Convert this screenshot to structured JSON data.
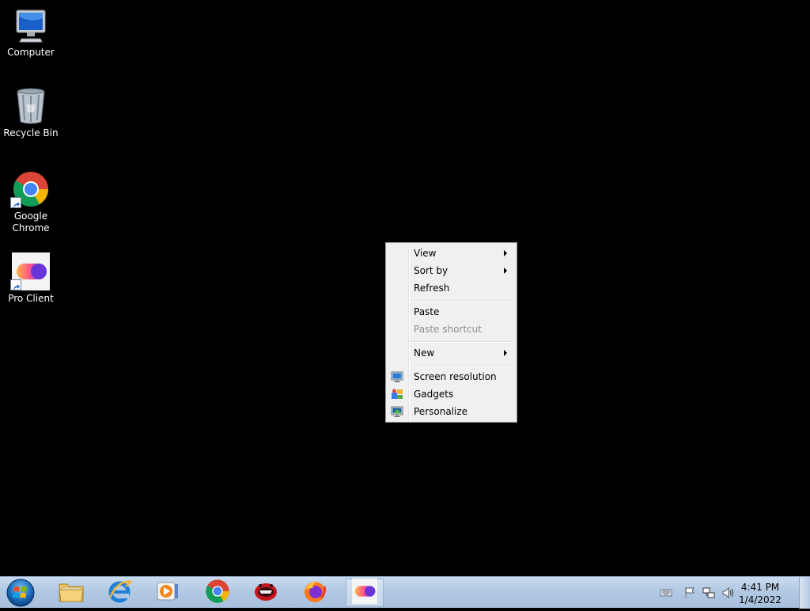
{
  "desktop": {
    "icons": [
      {
        "label": "Computer",
        "icon": "computer-icon"
      },
      {
        "label": "Recycle Bin",
        "icon": "recycle-bin-icon"
      },
      {
        "label": "Google Chrome",
        "icon": "chrome-icon",
        "shortcut": true
      },
      {
        "label": "Pro Client",
        "icon": "pro-client-icon",
        "shortcut": true
      }
    ]
  },
  "context_menu": {
    "view": "View",
    "sort_by": "Sort by",
    "refresh": "Refresh",
    "paste": "Paste",
    "paste_shortcut": "Paste shortcut",
    "new": "New",
    "screen_resolution": "Screen resolution",
    "gadgets": "Gadgets",
    "personalize": "Personalize"
  },
  "taskbar": {
    "pinned": [
      {
        "name": "windows-explorer",
        "icon": "folder-icon"
      },
      {
        "name": "internet-explorer",
        "icon": "ie-icon"
      },
      {
        "name": "media-player",
        "icon": "media-player-icon"
      },
      {
        "name": "google-chrome",
        "icon": "chrome-icon"
      },
      {
        "name": "red-app",
        "icon": "red-app-icon"
      },
      {
        "name": "firefox",
        "icon": "firefox-icon"
      },
      {
        "name": "pro-client",
        "icon": "pro-client-icon"
      }
    ],
    "clock": {
      "time": "4:41 PM",
      "date": "1/4/2022"
    }
  },
  "colors": {
    "desktop_bg": "#000000",
    "menu_bg": "#f0f0f0",
    "disabled_text": "#8d8d8d",
    "taskbar_top": "#c9dbee",
    "taskbar_bottom": "#a6bfdd"
  }
}
